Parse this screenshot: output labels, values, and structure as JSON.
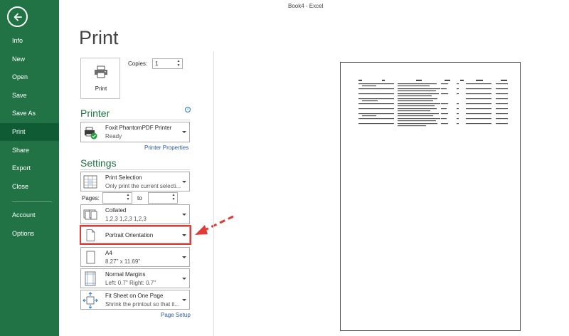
{
  "window_title": "Book4 - Excel",
  "nav": {
    "items": [
      "Info",
      "New",
      "Open",
      "Save",
      "Save As",
      "Print",
      "Share",
      "Export",
      "Close",
      "Account",
      "Options"
    ],
    "active": "Print"
  },
  "page_title": "Print",
  "print_button": {
    "label": "Print",
    "icon": "printer-icon"
  },
  "copies": {
    "label": "Copies:",
    "value": "1"
  },
  "printer": {
    "section": "Printer",
    "name": "Foxit PhantomPDF Printer",
    "status": "Ready",
    "properties_link": "Printer Properties",
    "icon": "printer-ready-icon"
  },
  "settings": {
    "section": "Settings",
    "print_what": {
      "title": "Print Selection",
      "subtitle": "Only print the current selecti..."
    },
    "pages": {
      "label": "Pages:",
      "to": "to",
      "from_value": "",
      "to_value": ""
    },
    "collation": {
      "title": "Collated",
      "subtitle": "1,2,3   1,2,3   1,2,3"
    },
    "orientation": {
      "title": "Portrait Orientation"
    },
    "paper": {
      "title": "A4",
      "subtitle": "8.27\" x 11.69\""
    },
    "margins": {
      "title": "Normal Margins",
      "subtitle": "Left: 0.7\"   Right: 0.7\""
    },
    "scaling": {
      "title": "Fit Sheet on One Page",
      "subtitle": "Shrink the printout so that it..."
    },
    "page_setup_link": "Page Setup"
  },
  "colors": {
    "accent": "#217346",
    "highlight": "#e03b36",
    "link": "#2b5797"
  }
}
